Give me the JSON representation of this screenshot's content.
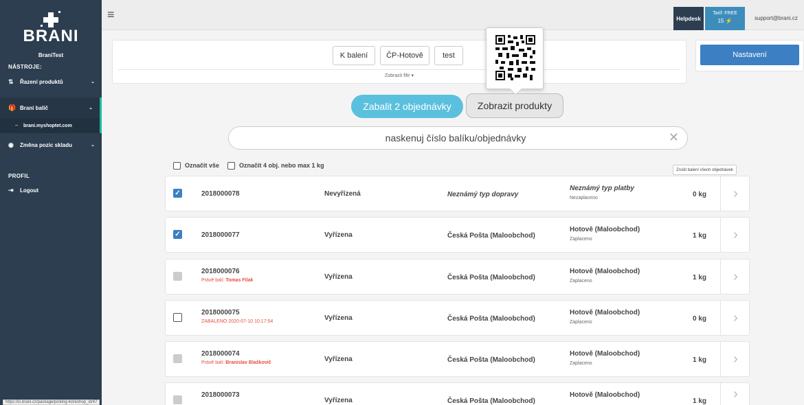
{
  "brand": {
    "logo_text": "BRANI"
  },
  "sidebar": {
    "user_name": "BraniTest",
    "tools_title": "NÁSTROJE:",
    "items": [
      {
        "label": "Řazení produktů"
      },
      {
        "label": "Brani balič"
      },
      {
        "label": "brani.myshoptet.com"
      },
      {
        "label": "Změna pozic skladu"
      }
    ],
    "profile_title": "PROFIL",
    "logout_label": "Logout"
  },
  "topbar": {
    "helpdesk": "Helpdesk",
    "tariff_label": "Tarif: FREE",
    "tariff_count": "15",
    "email": "support@brani.cz"
  },
  "filters": {
    "buttons": [
      "K balení",
      "ČP-Hotově",
      "test"
    ],
    "toggle_label": "Zobrazit filtr ▾"
  },
  "settings_button": "Nastavení",
  "actions": {
    "pack_label": "Zabalit 2 objednávky",
    "products_label": "Zobrazit produkty"
  },
  "search": {
    "placeholder": "naskenuj číslo balíku/objednávky"
  },
  "select": {
    "all_label": "Označit vše",
    "some_label": "Označit 4 obj. nebo max 1 kg",
    "cancel_all": "Zrušit balení všech objednávek"
  },
  "orders": [
    {
      "number": "2018000078",
      "note_prefix": "",
      "note_value": "",
      "state": "Nevyřízená",
      "shipping": "Neznámý typ dopravy",
      "payment": "Neznámý typ platby",
      "paid": "Nezaplaceno",
      "weight": "0 kg"
    },
    {
      "number": "2018000077",
      "note_prefix": "",
      "note_value": "",
      "state": "Vyřízena",
      "shipping": "Česká Pošta (Maloobchod)",
      "payment": "Hotově (Maloobchod)",
      "paid": "Zaplaceno",
      "weight": "1 kg"
    },
    {
      "number": "2018000076",
      "note_prefix": "Právě balí:",
      "note_value": "Tomas Filak",
      "state": "Vyřízena",
      "shipping": "Česká Pošta (Maloobchod)",
      "payment": "Hotově (Maloobchod)",
      "paid": "Zaplaceno",
      "weight": "1 kg"
    },
    {
      "number": "2018000075",
      "note_prefix": "ZABALENO",
      "note_value": "2020-07-10 10:17:54",
      "state": "Vyřízena",
      "shipping": "Česká Pošta (Maloobchod)",
      "payment": "Hotově (Maloobchod)",
      "paid": "Zaplaceno",
      "weight": "0 kg"
    },
    {
      "number": "2018000074",
      "note_prefix": "Právě balí:",
      "note_value": "Branislav Blaškovič",
      "state": "Vyřízena",
      "shipping": "Česká Pošta (Maloobchod)",
      "payment": "Hotově (Maloobchod)",
      "paid": "Zaplaceno",
      "weight": "1 kg"
    },
    {
      "number": "2018000073",
      "note_prefix": "",
      "note_value": "",
      "state": "Vyřízena",
      "shipping": "Česká Pošta (Maloobchod)",
      "payment": "Hotově (Maloobchod)",
      "paid": "",
      "weight": "1 kg"
    }
  ],
  "status_url": "https://is.brani.cz/package/picking-list/eshop_id/47",
  "colors": {
    "sidebar": "#2c3e50",
    "primary": "#3c7fc3",
    "pack": "#5bc0de",
    "accent": "#1abc9c",
    "alert": "#e74c3c"
  }
}
